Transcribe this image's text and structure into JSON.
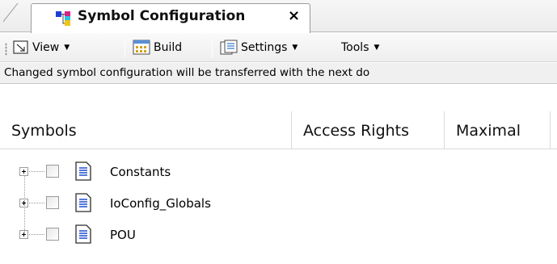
{
  "tab": {
    "title": "Symbol Configuration",
    "close_glyph": "×",
    "icon": "symbol-configuration-icon"
  },
  "toolbar": {
    "view_label": "View",
    "build_label": "Build",
    "settings_label": "Settings",
    "tools_label": "Tools",
    "dropdown_glyph": "▼"
  },
  "infobar": {
    "text": "Changed symbol configuration will be transferred with the next do"
  },
  "grid": {
    "columns": [
      "Symbols",
      "Access Rights",
      "Maximal"
    ]
  },
  "tree": {
    "items": [
      {
        "label": "Constants",
        "checked": false,
        "icon": "document-icon"
      },
      {
        "label": "IoConfig_Globals",
        "checked": false,
        "icon": "document-icon"
      },
      {
        "label": "POU",
        "checked": false,
        "icon": "document-icon"
      }
    ]
  },
  "colors": {
    "tab_background": "#ffffff",
    "toolbar_background": "#f0f0f0",
    "info_background": "#f0f0f0",
    "grid_lines": "#d9d9d9"
  }
}
